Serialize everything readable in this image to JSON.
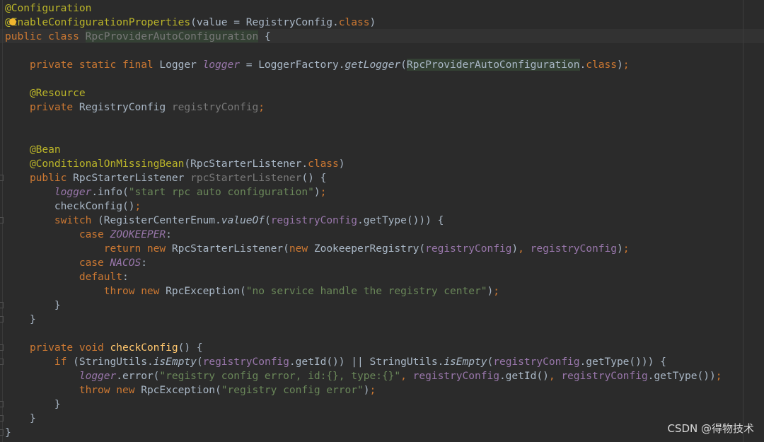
{
  "editor": {
    "watermark": "CSDN @得物技术",
    "lines": [
      [
        {
          "t": "@Configuration",
          "c": "an"
        }
      ],
      [
        {
          "t": "@EnableConfigurationProperties",
          "c": "an"
        },
        {
          "t": "(value = RegistryConfig.",
          "c": "tx"
        },
        {
          "t": "class",
          "c": "kw"
        },
        {
          "t": ")",
          "c": "tx"
        }
      ],
      [
        {
          "t": "public class ",
          "c": "kw"
        },
        {
          "t": "RpcProviderAutoConfiguration",
          "c": "hu"
        },
        {
          "t": " {",
          "c": "tx"
        }
      ],
      [],
      [
        {
          "t": "    private static final ",
          "c": "kw"
        },
        {
          "t": "Logger ",
          "c": "tx"
        },
        {
          "t": "logger",
          "c": "sf"
        },
        {
          "t": " = LoggerFactory.",
          "c": "tx"
        },
        {
          "t": "getLogger",
          "c": "it"
        },
        {
          "t": "(",
          "c": "tx"
        },
        {
          "t": "RpcProviderAutoConfiguration",
          "c": "hl"
        },
        {
          "t": ".",
          "c": "tx"
        },
        {
          "t": "class",
          "c": "kw"
        },
        {
          "t": ")",
          "c": "tx"
        },
        {
          "t": ";",
          "c": "kw"
        }
      ],
      [],
      [
        {
          "t": "    @Resource",
          "c": "an"
        }
      ],
      [
        {
          "t": "    private ",
          "c": "kw"
        },
        {
          "t": "RegistryConfig ",
          "c": "tx"
        },
        {
          "t": "registryConfig",
          "c": "un"
        },
        {
          "t": ";",
          "c": "kw"
        }
      ],
      [],
      [],
      [
        {
          "t": "    @Bean",
          "c": "an"
        }
      ],
      [
        {
          "t": "    @ConditionalOnMissingBean",
          "c": "an"
        },
        {
          "t": "(RpcStarterListener.",
          "c": "tx"
        },
        {
          "t": "class",
          "c": "kw"
        },
        {
          "t": ")",
          "c": "tx"
        }
      ],
      [
        {
          "t": "    public ",
          "c": "kw"
        },
        {
          "t": "RpcStarterListener ",
          "c": "tx"
        },
        {
          "t": "rpcStarterListener",
          "c": "un"
        },
        {
          "t": "() {",
          "c": "tx"
        }
      ],
      [
        {
          "t": "        ",
          "c": "tx"
        },
        {
          "t": "logger",
          "c": "sf"
        },
        {
          "t": ".info(",
          "c": "tx"
        },
        {
          "t": "\"start rpc auto configuration\"",
          "c": "st"
        },
        {
          "t": ")",
          "c": "tx"
        },
        {
          "t": ";",
          "c": "kw"
        }
      ],
      [
        {
          "t": "        checkConfig()",
          "c": "tx"
        },
        {
          "t": ";",
          "c": "kw"
        }
      ],
      [
        {
          "t": "        switch ",
          "c": "kw"
        },
        {
          "t": "(RegisterCenterEnum.",
          "c": "tx"
        },
        {
          "t": "valueOf",
          "c": "it"
        },
        {
          "t": "(",
          "c": "tx"
        },
        {
          "t": "registryConfig",
          "c": "fi"
        },
        {
          "t": ".getType())) {",
          "c": "tx"
        }
      ],
      [
        {
          "t": "            case ",
          "c": "kw"
        },
        {
          "t": "ZOOKEEPER",
          "c": "sf"
        },
        {
          "t": ":",
          "c": "tx"
        }
      ],
      [
        {
          "t": "                return new ",
          "c": "kw"
        },
        {
          "t": "RpcStarterListener(",
          "c": "tx"
        },
        {
          "t": "new ",
          "c": "kw"
        },
        {
          "t": "ZookeeperRegistry(",
          "c": "tx"
        },
        {
          "t": "registryConfig",
          "c": "fi"
        },
        {
          "t": ")",
          "c": "tx"
        },
        {
          "t": ", ",
          "c": "kw"
        },
        {
          "t": "registryConfig",
          "c": "fi"
        },
        {
          "t": ")",
          "c": "tx"
        },
        {
          "t": ";",
          "c": "kw"
        }
      ],
      [
        {
          "t": "            case ",
          "c": "kw"
        },
        {
          "t": "NACOS",
          "c": "sf"
        },
        {
          "t": ":",
          "c": "tx"
        }
      ],
      [
        {
          "t": "            default",
          "c": "kw"
        },
        {
          "t": ":",
          "c": "tx"
        }
      ],
      [
        {
          "t": "                throw new ",
          "c": "kw"
        },
        {
          "t": "RpcException(",
          "c": "tx"
        },
        {
          "t": "\"no service handle the registry center\"",
          "c": "st"
        },
        {
          "t": ")",
          "c": "tx"
        },
        {
          "t": ";",
          "c": "kw"
        }
      ],
      [
        {
          "t": "        }",
          "c": "tx"
        }
      ],
      [
        {
          "t": "    }",
          "c": "tx"
        }
      ],
      [],
      [
        {
          "t": "    private void ",
          "c": "kw"
        },
        {
          "t": "checkConfig",
          "c": "mt"
        },
        {
          "t": "() {",
          "c": "tx"
        }
      ],
      [
        {
          "t": "        if ",
          "c": "kw"
        },
        {
          "t": "(StringUtils.",
          "c": "tx"
        },
        {
          "t": "isEmpty",
          "c": "it"
        },
        {
          "t": "(",
          "c": "tx"
        },
        {
          "t": "registryConfig",
          "c": "fi"
        },
        {
          "t": ".getId()) || StringUtils.",
          "c": "tx"
        },
        {
          "t": "isEmpty",
          "c": "it"
        },
        {
          "t": "(",
          "c": "tx"
        },
        {
          "t": "registryConfig",
          "c": "fi"
        },
        {
          "t": ".getType())) {",
          "c": "tx"
        }
      ],
      [
        {
          "t": "            ",
          "c": "tx"
        },
        {
          "t": "logger",
          "c": "sf"
        },
        {
          "t": ".error(",
          "c": "tx"
        },
        {
          "t": "\"registry config error, id:{}, type:{}\"",
          "c": "st"
        },
        {
          "t": ", ",
          "c": "kw"
        },
        {
          "t": "registryConfig",
          "c": "fi"
        },
        {
          "t": ".getId()",
          "c": "tx"
        },
        {
          "t": ", ",
          "c": "kw"
        },
        {
          "t": "registryConfig",
          "c": "fi"
        },
        {
          "t": ".getType())",
          "c": "tx"
        },
        {
          "t": ";",
          "c": "kw"
        }
      ],
      [
        {
          "t": "            throw new ",
          "c": "kw"
        },
        {
          "t": "RpcException(",
          "c": "tx"
        },
        {
          "t": "\"registry config error\"",
          "c": "st"
        },
        {
          "t": ")",
          "c": "tx"
        },
        {
          "t": ";",
          "c": "kw"
        }
      ],
      [
        {
          "t": "        }",
          "c": "tx"
        }
      ],
      [
        {
          "t": "    }",
          "c": "tx"
        }
      ],
      [
        {
          "t": "}",
          "c": "tx"
        }
      ]
    ],
    "fold_markers": [
      12,
      15,
      21,
      22,
      24,
      25,
      28,
      29,
      30
    ],
    "token_colors": {
      "kw": "#cc7832",
      "an": "#bbb529",
      "tx": "#a9b7c6",
      "fi": "#9876aa",
      "st": "#6a8759",
      "un": "#787878",
      "mt": "#ffc66d",
      "hl": "#344134"
    }
  }
}
